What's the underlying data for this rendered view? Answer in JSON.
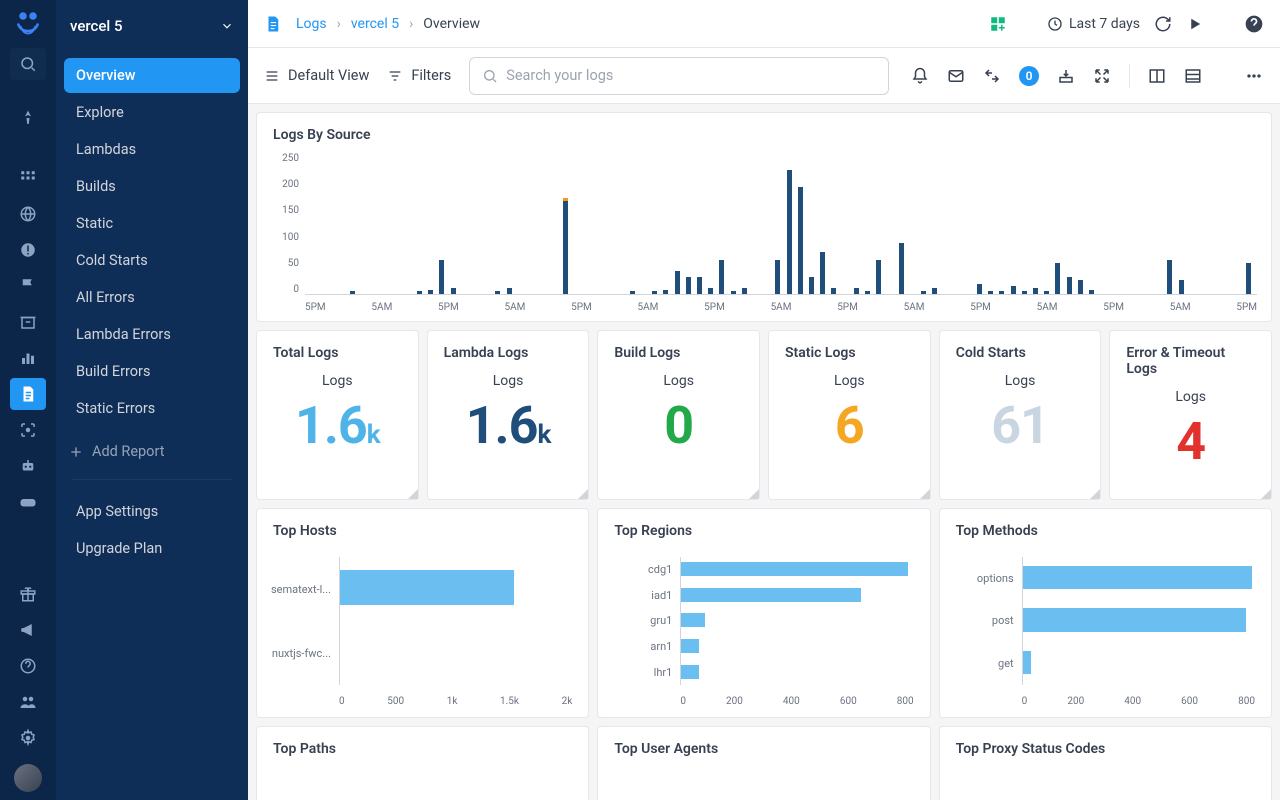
{
  "app": {
    "name": "vercel 5"
  },
  "breadcrumb": {
    "root": "Logs",
    "parent": "vercel 5",
    "current": "Overview"
  },
  "timeRange": "Last 7 days",
  "toolbar": {
    "defaultView": "Default View",
    "filters": "Filters",
    "searchPlaceholder": "Search your logs",
    "badge": "0"
  },
  "sidebar": {
    "items": [
      "Overview",
      "Explore",
      "Lambdas",
      "Builds",
      "Static",
      "Cold Starts",
      "All Errors",
      "Lambda Errors",
      "Build Errors",
      "Static Errors"
    ],
    "addReport": "Add Report",
    "footer": [
      "App Settings",
      "Upgrade Plan"
    ]
  },
  "chart_data": {
    "logsBySource": {
      "title": "Logs By Source",
      "type": "bar",
      "ylabel": "",
      "ylim": [
        0,
        250
      ],
      "yticks": [
        0,
        50,
        100,
        150,
        200,
        250
      ],
      "xticks": [
        "5PM",
        "5AM",
        "5PM",
        "5AM",
        "5PM",
        "5AM",
        "5PM",
        "5AM",
        "5PM",
        "5AM",
        "5PM",
        "5AM",
        "5PM",
        "5AM",
        "5PM"
      ],
      "values": [
        0,
        0,
        0,
        0,
        5,
        0,
        0,
        0,
        0,
        0,
        5,
        8,
        60,
        10,
        0,
        0,
        0,
        5,
        10,
        0,
        0,
        0,
        0,
        165,
        0,
        0,
        0,
        0,
        0,
        5,
        0,
        5,
        8,
        40,
        30,
        30,
        10,
        60,
        5,
        10,
        0,
        0,
        60,
        220,
        190,
        30,
        75,
        10,
        0,
        10,
        5,
        60,
        0,
        90,
        0,
        5,
        10,
        0,
        0,
        0,
        18,
        5,
        5,
        15,
        5,
        10,
        5,
        55,
        30,
        25,
        8,
        0,
        0,
        0,
        0,
        0,
        0,
        60,
        25,
        0,
        0,
        0,
        0,
        0,
        55
      ]
    },
    "topHosts": {
      "title": "Top Hosts",
      "type": "bar-h",
      "xlim": [
        0,
        2000
      ],
      "xticks": [
        "0",
        "500",
        "1k",
        "1.5k",
        "2k"
      ],
      "categories": [
        "sematext-l...",
        "nuxtjs-fwc..."
      ],
      "values": [
        1500,
        0
      ]
    },
    "topRegions": {
      "title": "Top Regions",
      "type": "bar-h",
      "xlim": [
        0,
        800
      ],
      "xticks": [
        "0",
        "200",
        "400",
        "600",
        "800"
      ],
      "categories": [
        "cdg1",
        "iad1",
        "gru1",
        "arn1",
        "lhr1"
      ],
      "values": [
        780,
        620,
        80,
        60,
        60
      ]
    },
    "topMethods": {
      "title": "Top Methods",
      "type": "bar-h",
      "xlim": [
        0,
        800
      ],
      "xticks": [
        "0",
        "200",
        "400",
        "600",
        "800"
      ],
      "categories": [
        "options",
        "post",
        "get"
      ],
      "values": [
        790,
        770,
        30
      ]
    },
    "topPaths": {
      "title": "Top Paths"
    },
    "topUserAgents": {
      "title": "Top User Agents"
    },
    "topProxyStatusCodes": {
      "title": "Top Proxy Status Codes"
    }
  },
  "stats": {
    "sub": "Logs",
    "total": {
      "title": "Total Logs",
      "value": "1.6",
      "suffix": "k",
      "color": "#4fb3e8"
    },
    "lambda": {
      "title": "Lambda Logs",
      "value": "1.6",
      "suffix": "k",
      "color": "#1e4e79"
    },
    "build": {
      "title": "Build Logs",
      "value": "0",
      "suffix": "",
      "color": "#22a94a"
    },
    "static": {
      "title": "Static Logs",
      "value": "6",
      "suffix": "",
      "color": "#f5a623"
    },
    "cold": {
      "title": "Cold Starts",
      "value": "61",
      "suffix": "",
      "color": "#c9d6e2"
    },
    "error": {
      "title": "Error & Timeout Logs",
      "value": "4",
      "suffix": "",
      "color": "#e1322d"
    }
  }
}
